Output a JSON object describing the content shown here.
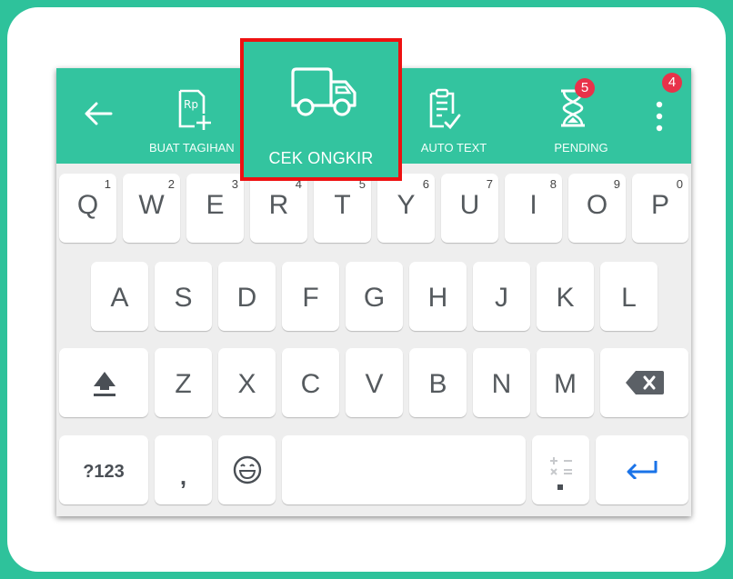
{
  "toolbar": {
    "back_icon": "arrow-left-icon",
    "items": [
      {
        "label": "BUAT TAGIHAN",
        "icon": "rp-invoice-add-icon"
      },
      {
        "label": "CEK ONGKIR",
        "icon": "delivery-truck-icon"
      },
      {
        "label": "AUTO TEXT",
        "icon": "clipboard-check-icon"
      },
      {
        "label": "PENDING",
        "icon": "hourglass-icon",
        "badge": "5"
      }
    ],
    "more_icon": "vertical-dots-icon",
    "more_badge": "4",
    "highlight_color": "#ee1111",
    "bar_color": "#33c49f",
    "badge_color": "#e8324a"
  },
  "keyboard": {
    "row1": [
      {
        "key": "Q",
        "num": "1"
      },
      {
        "key": "W",
        "num": "2"
      },
      {
        "key": "E",
        "num": "3"
      },
      {
        "key": "R",
        "num": "4"
      },
      {
        "key": "T",
        "num": "5"
      },
      {
        "key": "Y",
        "num": "6"
      },
      {
        "key": "U",
        "num": "7"
      },
      {
        "key": "I",
        "num": "8"
      },
      {
        "key": "O",
        "num": "9"
      },
      {
        "key": "P",
        "num": "0"
      }
    ],
    "row2": [
      "A",
      "S",
      "D",
      "F",
      "G",
      "H",
      "J",
      "K",
      "L"
    ],
    "row3": [
      "Z",
      "X",
      "C",
      "V",
      "B",
      "N",
      "M"
    ],
    "row4": {
      "symbols_label": "?123",
      "comma_label": ",",
      "emoji_icon": "emoji-icon",
      "math_icon": "plus-minus-times-equals-icon",
      "enter_icon": "enter-return-icon"
    },
    "shift_icon": "shift-arrow-icon",
    "backspace_icon": "backspace-icon",
    "enter_color": "#1a73e8"
  }
}
